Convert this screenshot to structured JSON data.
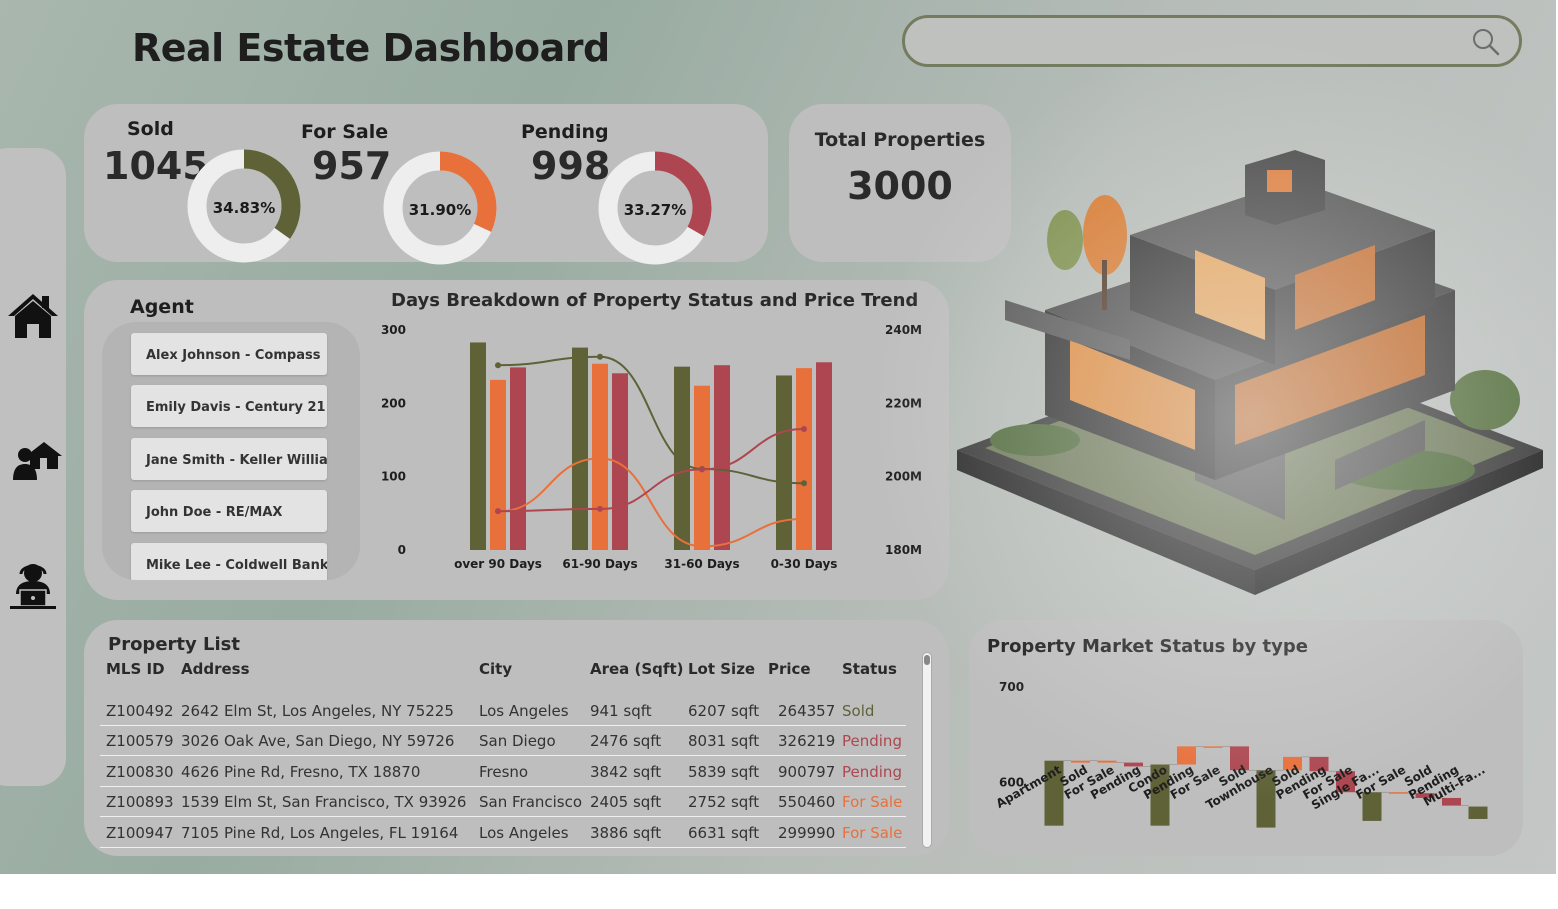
{
  "header": {
    "title": "Real Estate Dashboard",
    "search": {
      "value": "",
      "placeholder": ""
    }
  },
  "sidebar": {
    "items": [
      {
        "icon": "home-icon"
      },
      {
        "icon": "agent-home-icon"
      },
      {
        "icon": "support-agent-icon"
      }
    ]
  },
  "kpis": {
    "sold": {
      "label": "Sold",
      "value": "1045",
      "pct_label": "34.83%",
      "fraction": 0.3483,
      "color": "#5f6137"
    },
    "for_sale": {
      "label": "For Sale",
      "value": "957",
      "pct_label": "31.90%",
      "fraction": 0.319,
      "color": "#e8703b"
    },
    "pending": {
      "label": "Pending",
      "value": "998",
      "pct_label": "33.27%",
      "fraction": 0.3327,
      "color": "#ad4650"
    },
    "total": {
      "label": "Total Properties",
      "value": "3000"
    }
  },
  "agents": {
    "title": "Agent",
    "items": [
      "Alex Johnson - Compass",
      "Emily Davis - Century 21",
      "Jane Smith - Keller Willia...",
      "John Doe - RE/MAX",
      "Mike Lee - Coldwell Banker"
    ]
  },
  "chart_data": [
    {
      "type": "bar",
      "title": "Days Breakdown of Property Status and Price Trend",
      "categories": [
        "over 90 Days",
        "61-90 Days",
        "31-60 Days",
        "0-30 Days"
      ],
      "series": [
        {
          "values": [
            283,
            276,
            250,
            238
          ],
          "color": "#5f6137"
        },
        {
          "values": [
            232,
            254,
            224,
            248
          ],
          "color": "#e8703b"
        },
        {
          "values": [
            249,
            241,
            252,
            256
          ],
          "color": "#ad4650"
        }
      ],
      "ylim": [
        0,
        300
      ],
      "yticks": [
        "300",
        "200",
        "100",
        "0"
      ],
      "y2lim": [
        180,
        240
      ],
      "y2ticks": [
        "240M",
        "220M",
        "200M",
        "180M"
      ],
      "lines": [
        {
          "values": [
            230.4,
            232.7,
            202.1,
            198.2
          ],
          "color": "#5f6137"
        },
        {
          "values": [
            190.5,
            205.0,
            181.0,
            188.5
          ],
          "color": "#e8703b"
        },
        {
          "values": [
            190.6,
            191.2,
            202.0,
            213.0
          ],
          "color": "#ad4650"
        }
      ],
      "grid": false,
      "legend": "none"
    },
    {
      "type": "bar",
      "subtype": "waterfall",
      "title": "Property Market Status by type",
      "categories": [
        "Apartment",
        "Sold",
        "For Sale",
        "Pending",
        "Condo",
        "Pending",
        "For Sale",
        "Sold",
        "Townhouse",
        "Sold",
        "Pending",
        "For Sale",
        "Single Fa...",
        "For Sale",
        "Sold",
        "Pending",
        "Multi-Fa..."
      ],
      "steps": [
        {
          "low": 555,
          "high": 623,
          "color": "#5f6137"
        },
        {
          "low": 621,
          "high": 623,
          "color": "#e8703b"
        },
        {
          "low": 621,
          "high": 623,
          "color": "#e8703b"
        },
        {
          "low": 617,
          "high": 621,
          "color": "#ad4650"
        },
        {
          "low": 555,
          "high": 619,
          "color": "#5f6137"
        },
        {
          "low": 619,
          "high": 638,
          "color": "#e8703b"
        },
        {
          "low": 637,
          "high": 638,
          "color": "#e8703b"
        },
        {
          "low": 613,
          "high": 638,
          "color": "#ad4650"
        },
        {
          "low": 553,
          "high": 613,
          "color": "#5f6137"
        },
        {
          "low": 613,
          "high": 627,
          "color": "#e8703b"
        },
        {
          "low": 612,
          "high": 627,
          "color": "#ad4650"
        },
        {
          "low": 590,
          "high": 612,
          "color": "#ad4650"
        },
        {
          "low": 560,
          "high": 590,
          "color": "#5f6137"
        },
        {
          "low": 589,
          "high": 590,
          "color": "#e8703b"
        },
        {
          "low": 584,
          "high": 589,
          "color": "#ad4650"
        },
        {
          "low": 576,
          "high": 584,
          "color": "#ad4650"
        },
        {
          "low": 562,
          "high": 575,
          "color": "#5f6137"
        }
      ],
      "ylim": [
        540,
        720
      ],
      "yticks": [
        "700",
        "600"
      ],
      "grid": false,
      "legend": "none"
    }
  ],
  "property_list": {
    "title": "Property List",
    "columns": [
      "MLS ID",
      "Address",
      "City",
      "Area (Sqft)",
      "Lot Size",
      "Price",
      "Status"
    ],
    "rows": [
      [
        "Z100492",
        "2642 Elm St, Los Angeles, NY 75225",
        "Los Angeles",
        "941 sqft",
        "6207 sqft",
        "264357",
        "Sold"
      ],
      [
        "Z100579",
        "3026 Oak Ave, San Diego, NY 59726",
        "San Diego",
        "2476 sqft",
        "8031 sqft",
        "326219",
        "Pending"
      ],
      [
        "Z100830",
        "4626 Pine Rd, Fresno, TX 18870",
        "Fresno",
        "3842 sqft",
        "5839 sqft",
        "900797",
        "Pending"
      ],
      [
        "Z100893",
        "1539 Elm St, San Francisco, TX 93926",
        "San Francisco",
        "2405 sqft",
        "2752 sqft",
        "550460",
        "For Sale"
      ],
      [
        "Z100947",
        "7105 Pine Rd, Los Angeles, FL 19164",
        "Los Angeles",
        "3886 sqft",
        "6631 sqft",
        "299990",
        "For Sale"
      ]
    ],
    "status_colors": {
      "Sold": "#5f6137",
      "Pending": "#ad4650",
      "For Sale": "#e8703b"
    }
  },
  "image": {
    "name": "modern-house-illustration"
  }
}
